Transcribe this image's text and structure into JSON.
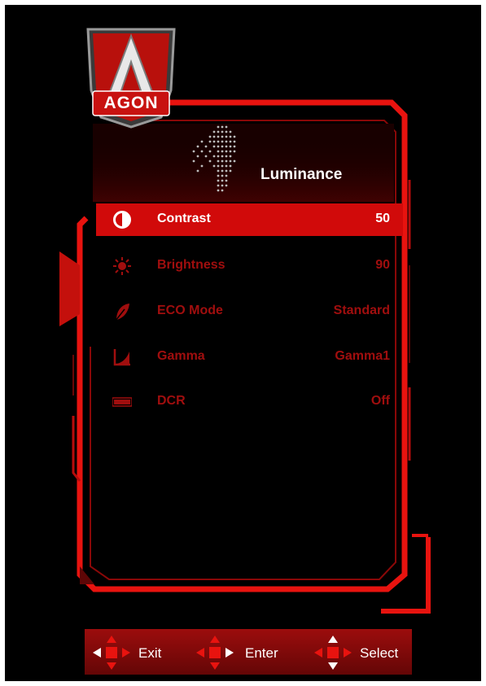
{
  "logo": {
    "text": "AGON"
  },
  "menu": {
    "title": "Luminance",
    "items": [
      {
        "label": "Contrast",
        "value": "50",
        "icon": "contrast-icon",
        "selected": true
      },
      {
        "label": "Brightness",
        "value": "90",
        "icon": "brightness-icon",
        "selected": false
      },
      {
        "label": "ECO Mode",
        "value": "Standard",
        "icon": "eco-leaf-icon",
        "selected": false
      },
      {
        "label": "Gamma",
        "value": "Gamma1",
        "icon": "gamma-curve-icon",
        "selected": false
      },
      {
        "label": "DCR",
        "value": "Off",
        "icon": "dcr-icon",
        "selected": false
      }
    ]
  },
  "footer": {
    "exit_label": "Exit",
    "enter_label": "Enter",
    "select_label": "Select"
  },
  "colors": {
    "accent": "#e00b0b",
    "dim_text": "#a00e0e",
    "background": "#000000"
  }
}
